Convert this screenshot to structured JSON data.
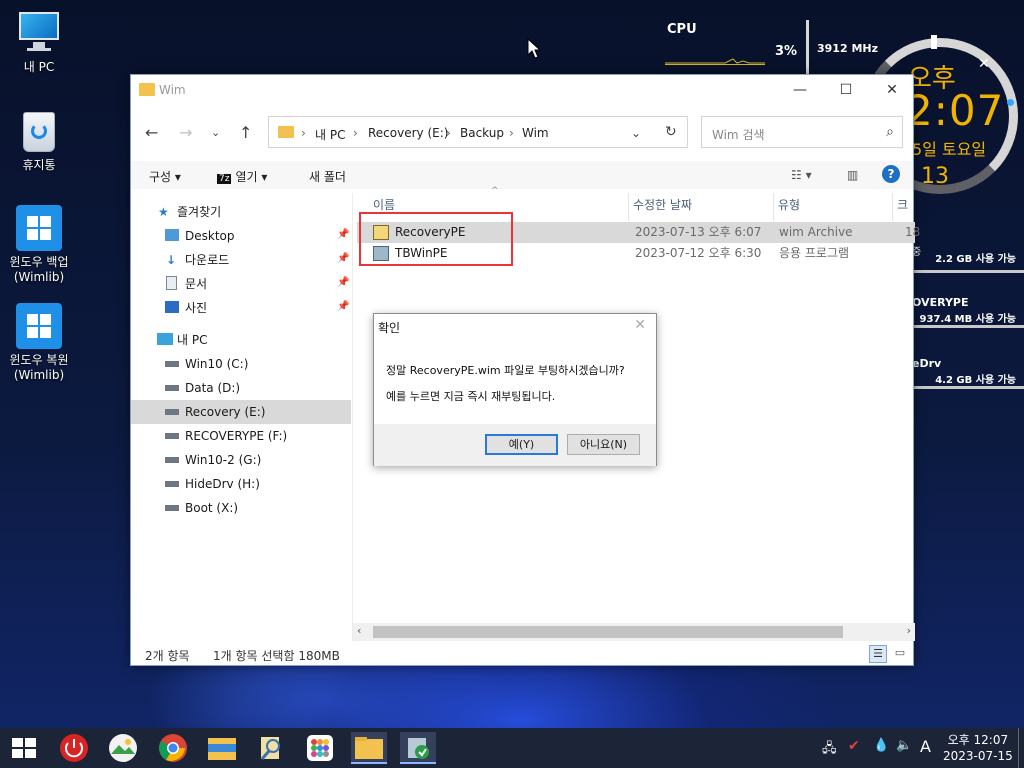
{
  "desktop": {
    "icons": [
      {
        "label": "내 PC"
      },
      {
        "label": "휴지통"
      },
      {
        "label": "윈도우 백업 (Wimlib)"
      },
      {
        "label": "윈도우 복원 (Wimlib)"
      }
    ],
    "cpu": {
      "label": "CPU",
      "percent": "3%",
      "freq": "3912 MHz"
    },
    "clock": {
      "ampm": "오후",
      "time": "2:07",
      "date": "5일 토요일",
      "seconds": "13"
    },
    "drives": [
      {
        "name": "",
        "prefix": "중",
        "free": "2.2 GB 사용 가능"
      },
      {
        "name": "OVERYPE",
        "prefix": "",
        "free": "937.4 MB 사용 가능"
      },
      {
        "name": "eDrv",
        "prefix": "",
        "free": "4.2 GB 사용 가능"
      }
    ]
  },
  "explorer": {
    "title": "Wim",
    "address": {
      "crumbs": [
        "내 PC",
        "Recovery (E:)",
        "Backup",
        "Wim"
      ]
    },
    "search_placeholder": "Wim 검색",
    "commands": {
      "organize": "구성",
      "open": "열기",
      "new_folder": "새 폴더"
    },
    "nav": {
      "quick_access": "즐겨찾기",
      "quick_items": [
        "Desktop",
        "다운로드",
        "문서",
        "사진"
      ],
      "this_pc": "내 PC",
      "drives": [
        "Win10 (C:)",
        "Data (D:)",
        "Recovery (E:)",
        "RECOVERYPE (F:)",
        "Win10-2 (G:)",
        "HideDrv (H:)",
        "Boot (X:)"
      ]
    },
    "columns": {
      "name": "이름",
      "modified": "수정한 날짜",
      "type": "유형",
      "size": "크"
    },
    "files": [
      {
        "name": "RecoveryPE",
        "modified": "2023-07-13 오후 6:07",
        "type": "wim Archive",
        "size": "18"
      },
      {
        "name": "TBWinPE",
        "modified": "2023-07-12 오후 6:30",
        "type": "응용 프로그램",
        "size": ""
      }
    ],
    "status": {
      "count": "2개 항목",
      "selection": "1개 항목 선택함 180MB"
    }
  },
  "dialog": {
    "title": "확인",
    "message1": "정말 RecoveryPE.wim 파일로 부팅하시겠습니까?",
    "message2": "예를 누르면 지금 즉시 재부팅됩니다.",
    "yes": "예(Y)",
    "no": "아니요(N)"
  },
  "taskbar": {
    "tray_lang": "A",
    "time": "오후 12:07",
    "date": "2023-07-15"
  },
  "colors": {
    "accent": "#2a78d8",
    "highlight_box": "#e8343a",
    "clock": "#f0b400"
  }
}
